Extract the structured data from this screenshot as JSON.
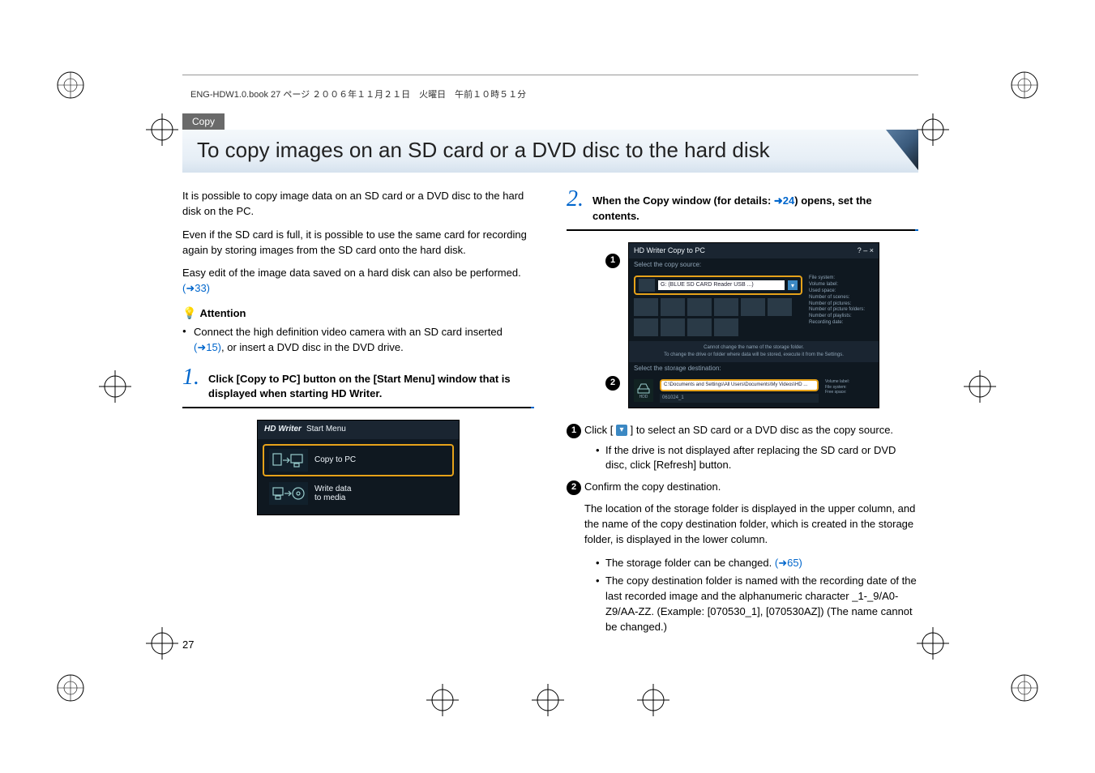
{
  "folio": "ENG-HDW1.0.book  27 ページ  ２００６年１１月２１日　火曜日　午前１０時５１分",
  "section": "Copy",
  "title": "To copy images on an SD card or a DVD disc to the hard disk",
  "left": {
    "p1": "It is possible to copy image data on an SD card or a DVD disc to the hard disk on the PC.",
    "p2": "Even if the SD card is full, it is possible to use the same card for recording again by storing images from the SD card onto the hard disk.",
    "p3a": "Easy edit of the image data saved on a hard disk can also be performed. ",
    "p3link": "(➜33)",
    "attention": "Attention",
    "bullet1a": "Connect the high definition video camera with an SD card inserted ",
    "bullet1link": "(➜15)",
    "bullet1b": ", or insert a DVD disc in the DVD drive.",
    "step1": "Click [Copy to PC] button on the [Start Menu] window that is displayed when starting HD Writer.",
    "fig1": {
      "brand": "HD Writer",
      "menu": "Start Menu",
      "copy": "Copy to PC",
      "write1": "Write data",
      "write2": "to media"
    }
  },
  "right": {
    "step2a": "When the Copy window (for details: ",
    "step2link": "➜24",
    "step2b": ") opens, set the contents.",
    "fig2": {
      "title": "HD Writer  Copy to PC",
      "src_field": "G:  (BLUE SD CARD Reader USB ...)",
      "msg1": "Cannot change the name of the storage folder.",
      "msg2": "To change the drive or folder where data will be stored, execute it from the Settings.",
      "dest1": "C:\\Documents and Settings\\All Users\\Documents\\My Videos\\HD ...",
      "dest2": "061024_1",
      "hd": "HDD"
    },
    "n1a": "Click [ ",
    "n1b": " ] to select an SD card or a DVD disc as the copy source.",
    "n1s1": "If the drive is not displayed after replacing the SD card or DVD disc, click [Refresh] button.",
    "n2": "Confirm the copy destination.",
    "n2p": "The location of the storage folder is displayed in the upper column, and the name of the copy destination folder, which is created in the storage folder, is displayed in the lower column.",
    "n2s1a": "The storage folder can be changed. ",
    "n2s1link": "(➜65)",
    "n2s2": "The copy destination folder is named with the recording date of the last recorded image and the alphanumeric character _1-_9/A0-Z9/AA-ZZ. (Example: [070530_1], [070530AZ]) (The name cannot be changed.)"
  },
  "pageNumber": "27",
  "stepNums": {
    "one": "1.",
    "two": "2."
  },
  "roundNums": {
    "one": "1",
    "two": "2"
  }
}
